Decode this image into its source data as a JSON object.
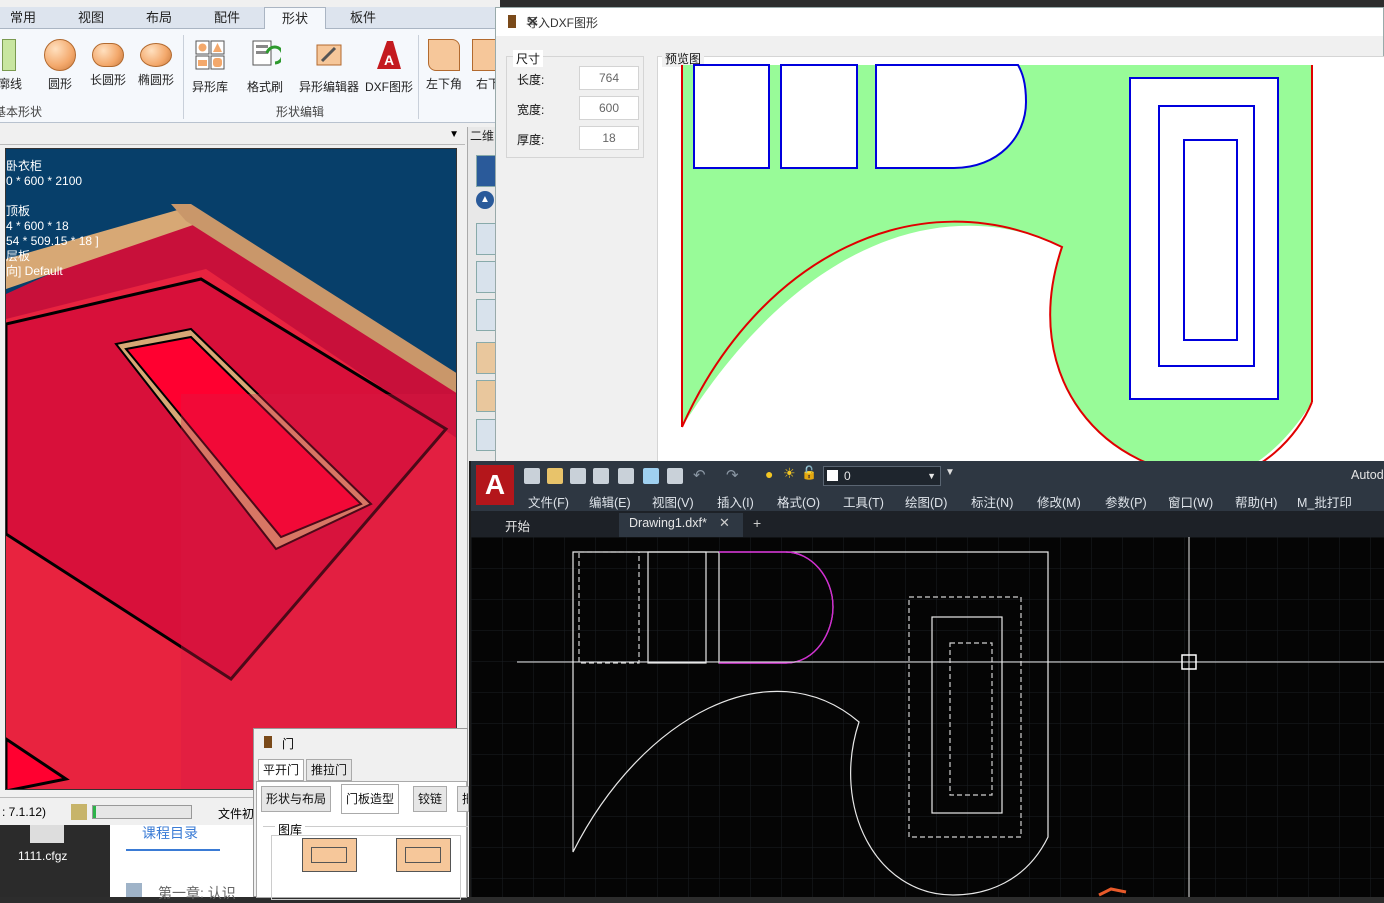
{
  "bg_app": {
    "tabs": [
      "常用",
      "视图",
      "布局",
      "配件",
      "形状",
      "板件"
    ],
    "active_tab": "形状",
    "ribbon_buttons": [
      "廓线",
      "圆形",
      "长圆形",
      "椭圆形",
      "异形库",
      "格式刷",
      "异形编辑器",
      "DXF图形",
      "左下角",
      "右下"
    ],
    "groups": [
      "基本形状",
      "形状编辑"
    ],
    "viewport_info": [
      "卧衣柜",
      "0 * 600 * 2100",
      "",
      "顶板",
      "4 * 600 * 18",
      "54 * 509.15 * 18 ]",
      "层板",
      "向] Default"
    ],
    "side_header": "二维",
    "status_version": ": 7.1.12)",
    "status_label": "文件初",
    "desktop_file": "1111.cfgz",
    "doc_heading": "课程目录",
    "doc_line": "第一章: 认识"
  },
  "door_dialog": {
    "title": "门",
    "tabs_row1": [
      "平开门",
      "推拉门"
    ],
    "tabs_row2": [
      "形状与布局",
      "门板造型",
      "铰链",
      "把"
    ],
    "active_tab": "门板造型",
    "library_label": "图库"
  },
  "dxf_dialog": {
    "title": "导入DXF图形",
    "size_group": "尺寸",
    "fields": [
      {
        "label": "长度:",
        "value": "764"
      },
      {
        "label": "宽度:",
        "value": "600"
      },
      {
        "label": "厚度:",
        "value": "18"
      }
    ],
    "preview_label": "预览图",
    "colors": {
      "fill": "#98fb98",
      "outline": "#e00000",
      "inner": "#0000dd"
    }
  },
  "autocad": {
    "brand": "Autod",
    "layer_value": "0",
    "menu": [
      "文件(F)",
      "编辑(E)",
      "视图(V)",
      "插入(I)",
      "格式(O)",
      "工具(T)",
      "绘图(D)",
      "标注(N)",
      "修改(M)",
      "参数(P)",
      "窗口(W)",
      "帮助(H)",
      "M_批打印"
    ],
    "tabs": [
      "开始",
      "Drawing1.dxf*"
    ]
  }
}
